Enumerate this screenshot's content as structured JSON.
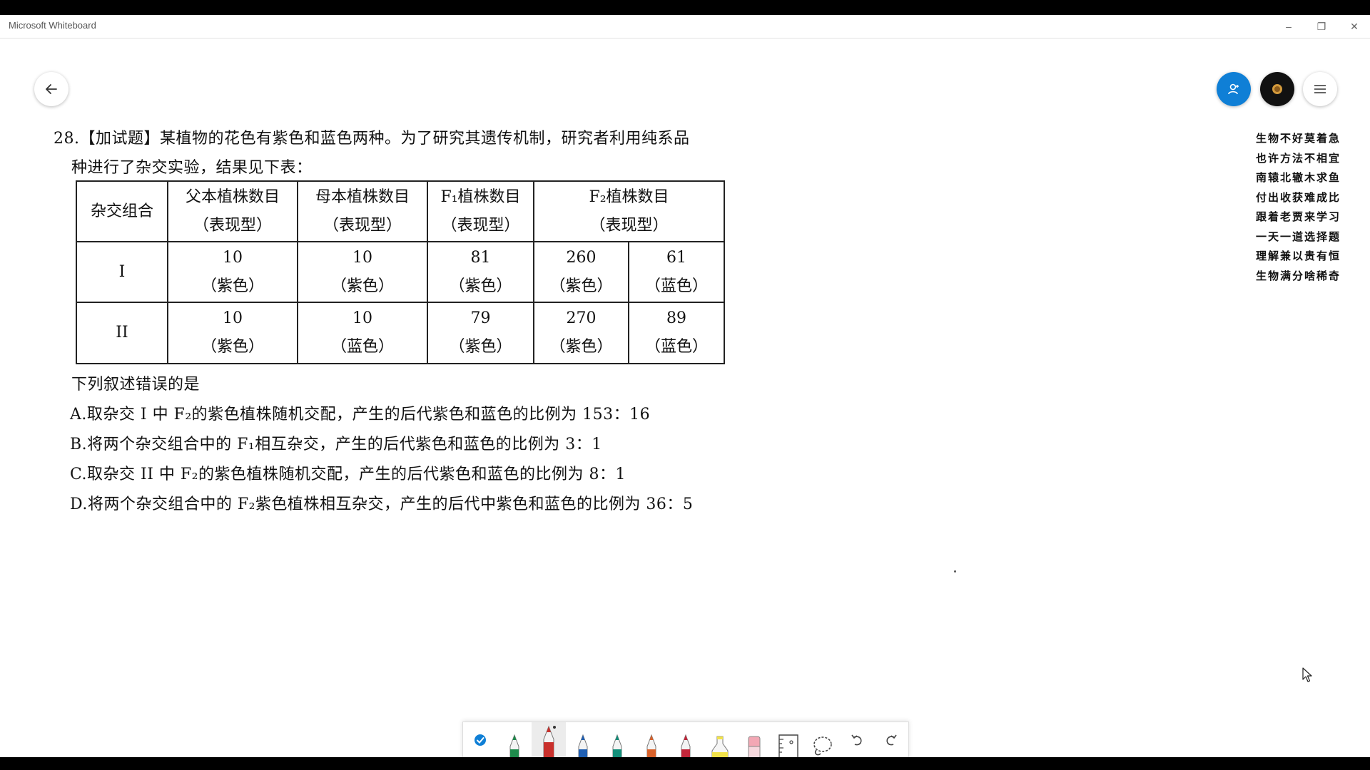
{
  "window": {
    "title": "Microsoft Whiteboard",
    "minimize_glyph": "–",
    "restore_glyph": "❐",
    "close_glyph": "✕"
  },
  "question": {
    "line1": "28.【加试题】某植物的花色有紫色和蓝色两种。为了研究其遗传机制，研究者利用纯系品",
    "line2": "种进行了杂交实验，结果见下表：",
    "prompt": "下列叙述错误的是",
    "options": [
      {
        "letter": "A.",
        "text": "取杂交 I 中 F₂的紫色植株随机交配，产生的后代紫色和蓝色的比例为 153：16"
      },
      {
        "letter": "B.",
        "text": "将两个杂交组合中的 F₁相互杂交，产生的后代紫色和蓝色的比例为 3：1"
      },
      {
        "letter": "C.",
        "text": "取杂交 II 中 F₂的紫色植株随机交配，产生的后代紫色和蓝色的比例为 8：1"
      },
      {
        "letter": "D.",
        "text": "将两个杂交组合中的 F₂紫色植株相互杂交，产生的后代中紫色和蓝色的比例为 36：5"
      }
    ]
  },
  "table": {
    "headers": [
      {
        "top": "杂交组合",
        "bottom": ""
      },
      {
        "top": "父本植株数目",
        "bottom": "（表现型）"
      },
      {
        "top": "母本植株数目",
        "bottom": "（表现型）"
      },
      {
        "top": "F₁植株数目",
        "bottom": "（表现型）"
      },
      {
        "top": "F₂植株数目",
        "bottom": "（表现型）"
      }
    ],
    "rows": [
      {
        "group": "I",
        "cells": [
          {
            "n": "10",
            "t": "（紫色）"
          },
          {
            "n": "10",
            "t": "（紫色）"
          },
          {
            "n": "81",
            "t": "（紫色）"
          },
          {
            "n": "260",
            "t": "（紫色）"
          },
          {
            "n": "61",
            "t": "（蓝色）"
          }
        ]
      },
      {
        "group": "II",
        "cells": [
          {
            "n": "10",
            "t": "（紫色）"
          },
          {
            "n": "10",
            "t": "（蓝色）"
          },
          {
            "n": "79",
            "t": "（紫色）"
          },
          {
            "n": "270",
            "t": "（紫色）"
          },
          {
            "n": "89",
            "t": "（蓝色）"
          }
        ]
      }
    ]
  },
  "poem": [
    "生物不好莫着急",
    "也许方法不相宜",
    "南辕北辙木求鱼",
    "付出收获难成比",
    "跟着老贾来学习",
    "一天一道选择题",
    "理解兼以贵有恒",
    "生物满分啥稀奇"
  ],
  "colors": {
    "accent_blue": "#0f7fd6",
    "pen_green": "#1e8b4c",
    "pen_red": "#c9302c",
    "pen_blue": "#1f5fb3",
    "pen_teal": "#138f7a",
    "pen_orange": "#d9622b",
    "pen_crimson": "#c2263a",
    "highlighter_yellow": "#f1e24a",
    "eraser_pink": "#f3a7b4"
  },
  "toolbar": {
    "tools": [
      "select-check-icon",
      "green-pen-icon",
      "red-pen-icon",
      "blue-pen-icon",
      "teal-pen-icon",
      "orange-pen-icon",
      "crimson-pen-icon",
      "highlighter-icon",
      "eraser-icon",
      "ruler-icon",
      "lasso-icon",
      "undo-icon",
      "redo-icon"
    ]
  }
}
